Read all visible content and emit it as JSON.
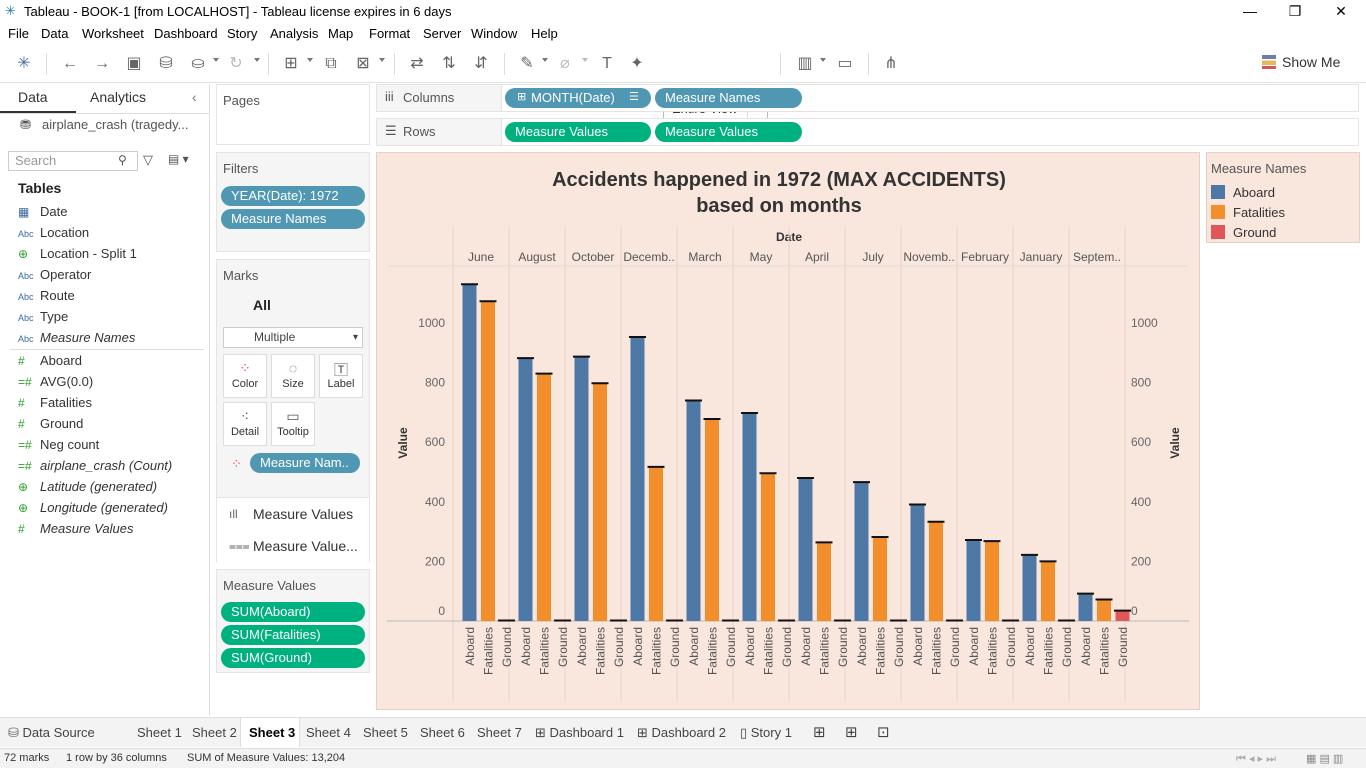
{
  "window": {
    "title": "Tableau - BOOK-1 [from LOCALHOST] - Tableau license expires in 6 days",
    "minimize": "—",
    "restore": "❐",
    "close": "✕"
  },
  "menu": [
    "File",
    "Data",
    "Worksheet",
    "Dashboard",
    "Story",
    "Analysis",
    "Map",
    "Format",
    "Server",
    "Window",
    "Help"
  ],
  "toolbar": {
    "view_select": "Entire View",
    "show_me": "Show Me"
  },
  "datapane": {
    "tab_data": "Data",
    "tab_analytics": "Analytics",
    "datasource": "airplane_crash (tragedy...",
    "search_placeholder": "Search",
    "tables_label": "Tables",
    "dimensions": [
      {
        "type": "date",
        "name": "Date"
      },
      {
        "type": "Abc",
        "name": "Location"
      },
      {
        "type": "geo",
        "name": "Location - Split 1"
      },
      {
        "type": "Abc",
        "name": "Operator"
      },
      {
        "type": "Abc",
        "name": "Route"
      },
      {
        "type": "Abc",
        "name": "Type"
      },
      {
        "type": "Abc",
        "name": "Measure Names",
        "italic": true
      }
    ],
    "measures": [
      {
        "type": "#",
        "name": "Aboard"
      },
      {
        "type": "=#",
        "name": "AVG(0.0)"
      },
      {
        "type": "#",
        "name": "Fatalities"
      },
      {
        "type": "#",
        "name": "Ground"
      },
      {
        "type": "=#",
        "name": "Neg count"
      },
      {
        "type": "=#",
        "name": "airplane_crash (Count)",
        "italic": true
      },
      {
        "type": "geo",
        "name": "Latitude (generated)",
        "italic": true
      },
      {
        "type": "geo",
        "name": "Longitude (generated)",
        "italic": true
      },
      {
        "type": "#",
        "name": "Measure Values",
        "italic": true
      }
    ]
  },
  "shelves": {
    "pages": "Pages",
    "filters": "Filters",
    "filter_pills": [
      "YEAR(Date): 1972",
      "Measure Names"
    ],
    "marks": "Marks",
    "marks_all": "All",
    "mark_type": "Multiple",
    "mark_buttons": [
      "Color",
      "Size",
      "Label",
      "Detail",
      "Tooltip"
    ],
    "color_pill": "Measure Nam..",
    "mv_rows": [
      "Measure Values",
      "Measure Value..."
    ],
    "measure_values": "Measure Values",
    "mv_pills": [
      "SUM(Aboard)",
      "SUM(Fatalities)",
      "SUM(Ground)"
    ],
    "columns": "Columns",
    "rows": "Rows",
    "column_pills": [
      "MONTH(Date)",
      "Measure Names"
    ],
    "row_pills": [
      "Measure Values",
      "Measure Values"
    ]
  },
  "legend": {
    "title": "Measure Names",
    "items": [
      {
        "name": "Aboard",
        "color": "#4e79a7"
      },
      {
        "name": "Fatalities",
        "color": "#f28e2b"
      },
      {
        "name": "Ground",
        "color": "#e15759"
      }
    ]
  },
  "chart_data": {
    "type": "bar",
    "title": "Accidents happened in 1972 (MAX ACCIDENTS)",
    "subtitle": "based on months",
    "header": "Date",
    "ylabel": "Value",
    "ylabel_right": "Value",
    "ylim": [
      0,
      1150
    ],
    "yticks": [
      0,
      200,
      400,
      600,
      800,
      1000
    ],
    "categories": [
      "June",
      "August",
      "October",
      "Decemb..",
      "March",
      "May",
      "April",
      "July",
      "Novemb..",
      "February",
      "January",
      "Septem.."
    ],
    "subcategories": [
      "Aboard",
      "Fatalities",
      "Ground"
    ],
    "series": [
      {
        "name": "Aboard",
        "color": "#4e79a7",
        "values": [
          1130,
          882,
          887,
          953,
          740,
          698,
          480,
          466,
          391,
          272,
          222,
          92
        ]
      },
      {
        "name": "Fatalities",
        "color": "#f28e2b",
        "values": [
          1073,
          830,
          798,
          0,
          678,
          0,
          0,
          0,
          0,
          0,
          0,
          72
        ]
      },
      {
        "name": "Ground",
        "color": "#e15759",
        "values": [
          0,
          0,
          0,
          0,
          0,
          0,
          0,
          0,
          0,
          0,
          0,
          35
        ]
      }
    ],
    "values_detail": {
      "Decemb.. Fatalities": 517,
      "May Fatalities": 496,
      "April Fatalities": 264,
      "July Fatalities": 282,
      "Novemb.. Fatalities": 333,
      "February Fatalities": 268,
      "January Fatalities": 200
    },
    "grid": true
  },
  "sheettabs": {
    "data_source": "Data Source",
    "sheets": [
      "Sheet 1",
      "Sheet 2",
      "Sheet 3",
      "Sheet 4",
      "Sheet 5",
      "Sheet 6",
      "Sheet 7"
    ],
    "active": "Sheet 3",
    "dashboards": [
      "Dashboard 1",
      "Dashboard 2"
    ],
    "story": "Story 1"
  },
  "status": {
    "marks": "72 marks",
    "dims": "1 row by 36 columns",
    "sum": "SUM of Measure Values: 13,204"
  }
}
